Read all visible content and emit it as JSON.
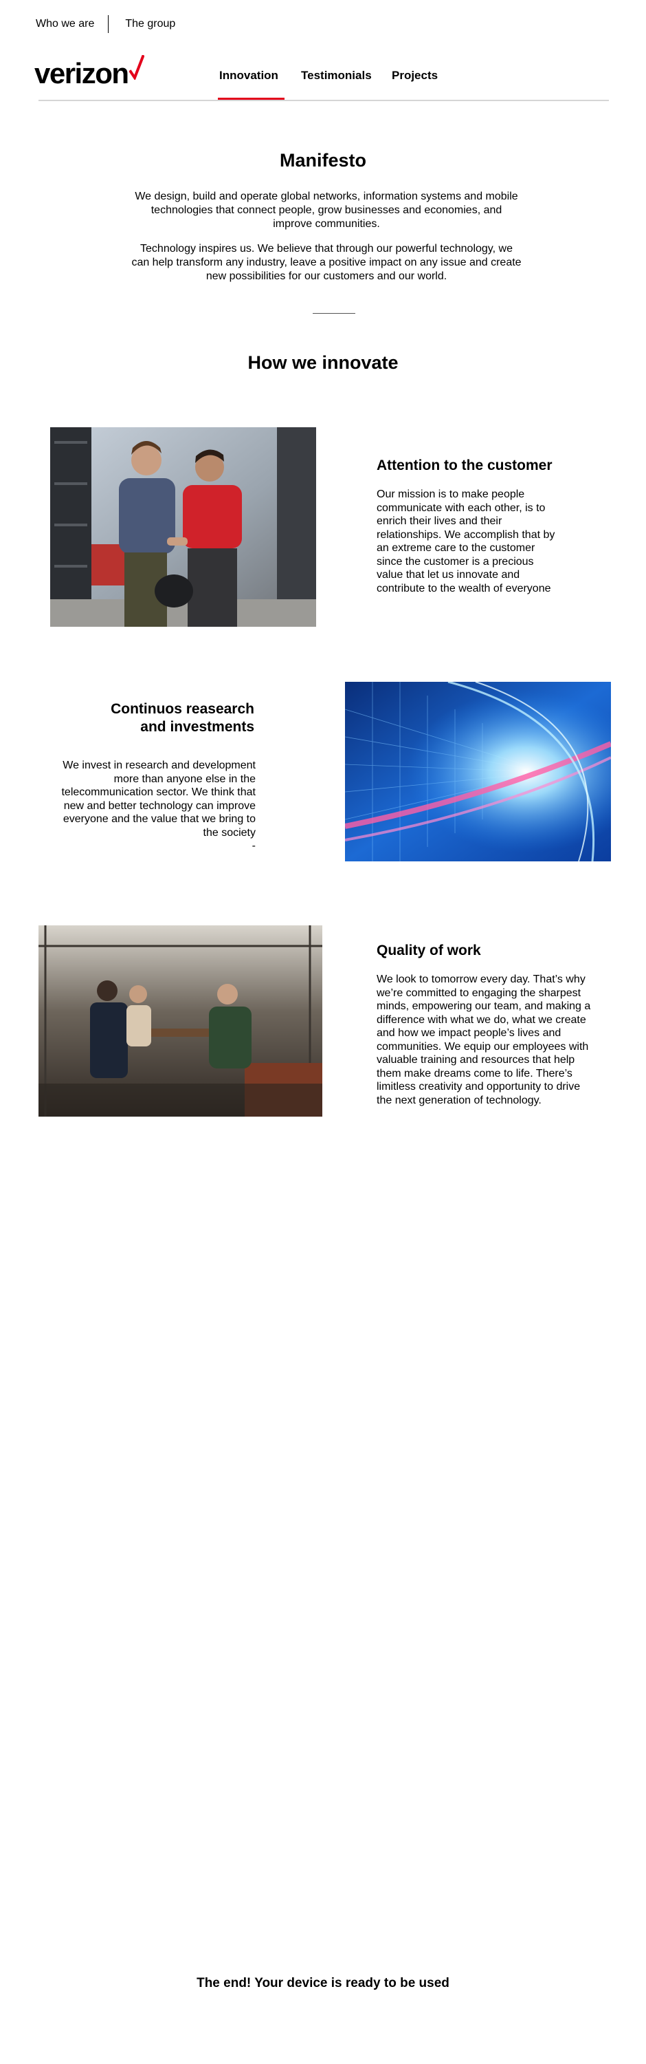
{
  "topnav": {
    "who_we_are": "Who we are",
    "the_group": "The group"
  },
  "logo": {
    "wordmark": "verizon",
    "icon": "checkmark-icon",
    "accent_color": "#e3001b"
  },
  "mainnav": {
    "tabs": [
      {
        "label": "Innovation",
        "active": true
      },
      {
        "label": "Testimonials",
        "active": false
      },
      {
        "label": "Projects",
        "active": false
      }
    ]
  },
  "manifesto": {
    "title": "Manifesto",
    "paragraph_1": "We design, build and operate global networks, information systems and mobile technologies that connect people, grow businesses and economies, and improve communities.",
    "paragraph_2": "Technology inspires us. We believe that through our powerful technology, we can help transform any industry, leave a positive impact on any issue and create new possibilities for our customers and our world."
  },
  "innovate": {
    "title": "How we innovate",
    "features": [
      {
        "title": "Attention to the customer",
        "text": "Our mission is to make people communicate with each other, is to enrich their lives and their relationships. We accomplish that by an extreme care to the customer since the customer is a precious value that let us innovate and contribute to the wealth of everyone",
        "image": "two-men-handshake-photo"
      },
      {
        "title": "Continuos reasearch and investments",
        "text": "We invest in research and development more than anyone else in the telecommunication sector. We think that new and better technology can improve everyone and the value that we bring to the society",
        "trailing_mark": "-",
        "image": "light-speed-tunnel-photo"
      },
      {
        "title": "Quality of work",
        "text": "We look to tomorrow every day. That’s why we’re committed to engaging the sharpest minds, empowering our team, and making a difference with what we do, what we create and how we impact people’s lives and communities. We equip our employees with valuable training and resources that help them make dreams come to life. There’s limitless creativity and opportunity to drive the next generation of technology.",
        "image": "people-in-restaurant-photo"
      }
    ]
  },
  "footer": {
    "end_message": "The end! Your device is ready to be used"
  }
}
